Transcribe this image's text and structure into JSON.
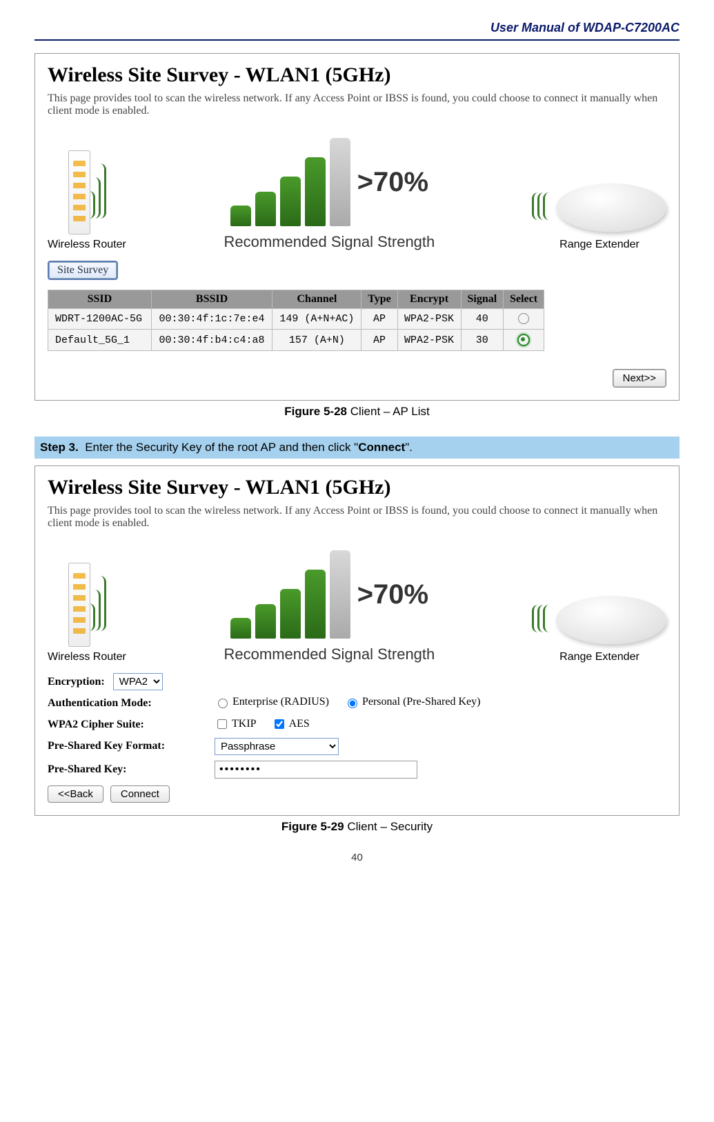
{
  "header": {
    "title": "User Manual of WDAP-C7200AC"
  },
  "survey": {
    "title": "Wireless Site Survey - WLAN1 (5GHz)",
    "desc": "This page provides tool to scan the wireless network. If any Access Point or IBSS is found, you could choose to connect it manually when client mode is enabled.",
    "router_label": "Wireless Router",
    "rec_label": "Recommended Signal Strength",
    "pct": ">70%",
    "extender_label": "Range Extender",
    "site_survey_btn": "Site Survey",
    "next_btn": "Next>>"
  },
  "table": {
    "headers": [
      "SSID",
      "BSSID",
      "Channel",
      "Type",
      "Encrypt",
      "Signal",
      "Select"
    ],
    "rows": [
      {
        "ssid": "WDRT-1200AC-5G",
        "bssid": "00:30:4f:1c:7e:e4",
        "channel": "149 (A+N+AC)",
        "type": "AP",
        "encrypt": "WPA2-PSK",
        "signal": "40",
        "selected": false
      },
      {
        "ssid": "Default_5G_1",
        "bssid": "00:30:4f:b4:c4:a8",
        "channel": "157 (A+N)",
        "type": "AP",
        "encrypt": "WPA2-PSK",
        "signal": "30",
        "selected": true
      }
    ]
  },
  "caption1": {
    "bold": "Figure 5-28",
    "rest": " Client – AP List"
  },
  "step": {
    "label": "Step 3.",
    "text_before": "Enter the Security Key of the root AP and then click \"",
    "bold": "Connect",
    "text_after": "\"."
  },
  "form": {
    "encryption_label": "Encryption:",
    "encryption_value": "WPA2",
    "auth_label": "Authentication Mode:",
    "auth_opts": [
      {
        "label": "Enterprise (RADIUS)",
        "checked": false
      },
      {
        "label": "Personal (Pre-Shared Key)",
        "checked": true
      }
    ],
    "cipher_label": "WPA2 Cipher Suite:",
    "cipher_opts": [
      {
        "label": "TKIP",
        "checked": false
      },
      {
        "label": "AES",
        "checked": true
      }
    ],
    "pkf_label": "Pre-Shared Key Format:",
    "pkf_value": "Passphrase",
    "pk_label": "Pre-Shared Key:",
    "pk_value": "••••••••",
    "back_btn": "<<Back",
    "connect_btn": "Connect"
  },
  "caption2": {
    "bold": "Figure 5-29",
    "rest": " Client – Security"
  },
  "page_num": "40"
}
